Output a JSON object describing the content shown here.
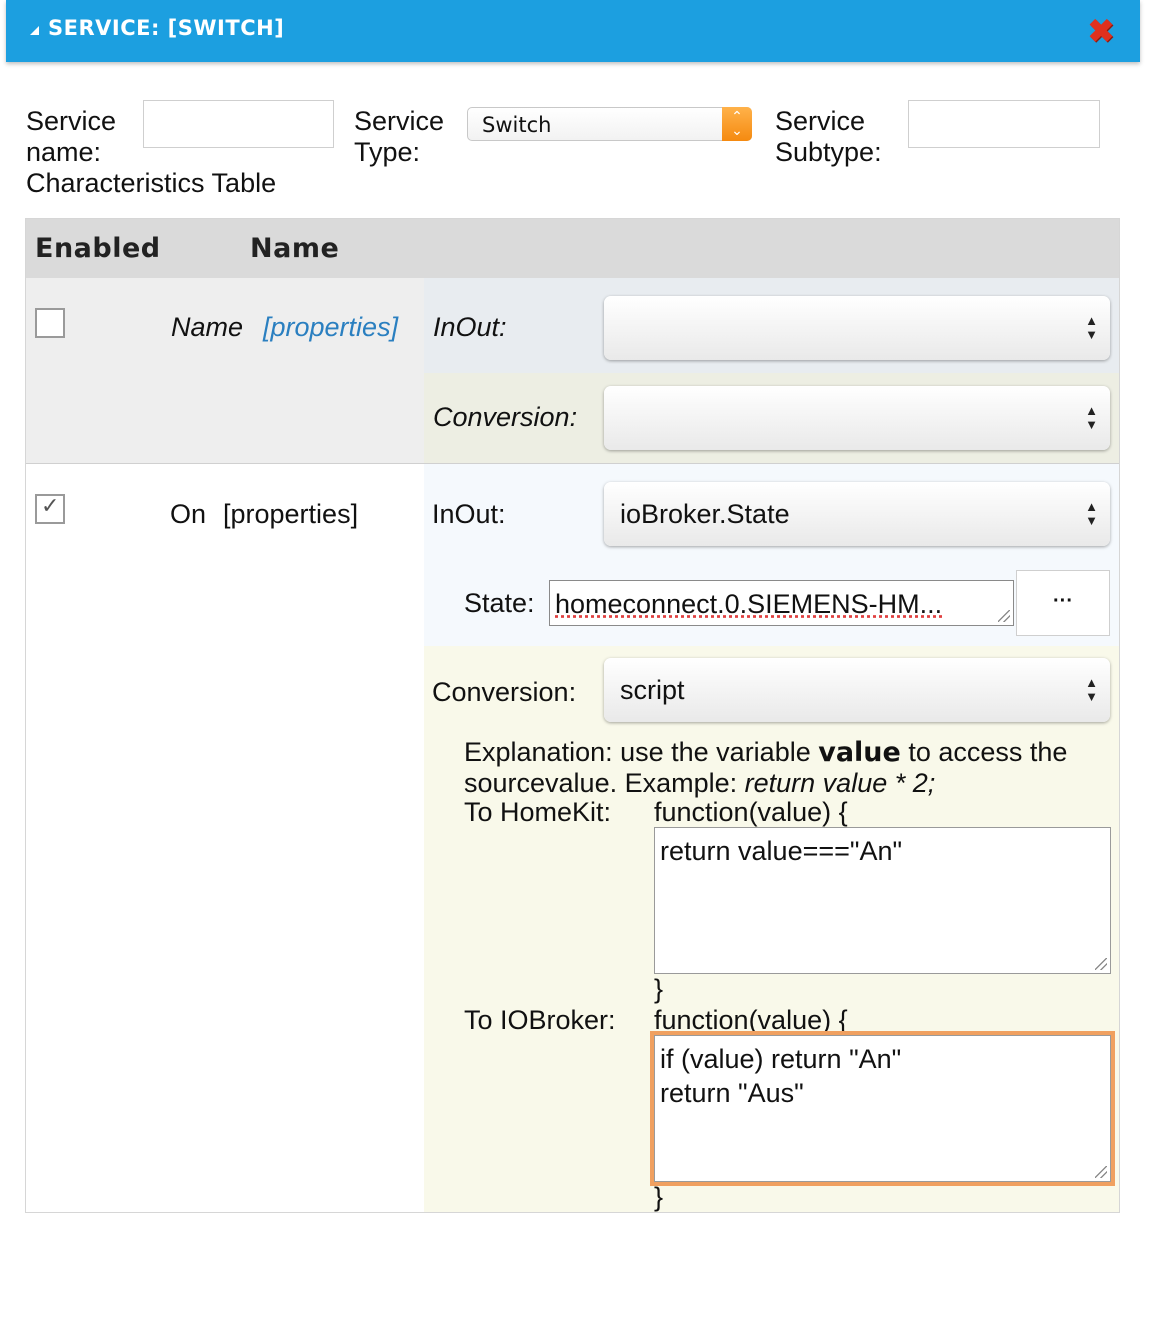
{
  "dialog": {
    "title": "SERVICE: [SWITCH]"
  },
  "form": {
    "service_name_label": "Service name:",
    "service_name_value": "",
    "service_type_label": "Service Type:",
    "service_type_value": "Switch",
    "service_subtype_label": "Service Subtype:",
    "service_subtype_value": "",
    "characteristics_table_label": "Characteristics Table"
  },
  "table": {
    "headers": {
      "enabled": "Enabled",
      "name": "Name"
    },
    "rows": [
      {
        "enabled": false,
        "name": "Name",
        "properties_link": "[properties]",
        "inout_label": "InOut:",
        "inout_value": "",
        "conversion_label": "Conversion:",
        "conversion_value": ""
      },
      {
        "enabled": true,
        "name": "On",
        "properties_link": "[properties]",
        "inout_label": "InOut:",
        "inout_value": "ioBroker.State",
        "state_label": "State:",
        "state_value": "homeconnect.0.SIEMENS-HM...",
        "browse_button": "···",
        "conversion_label": "Conversion:",
        "conversion_value": "script",
        "explanation_prefix": "Explanation: use the variable ",
        "explanation_bold": "value",
        "explanation_mid": " to access the sourcevalue. Example: ",
        "explanation_example": "return value * 2;",
        "to_homekit_label": "To HomeKit:",
        "to_homekit_open": "function(value) {",
        "to_homekit_code": "return value===\"An\"",
        "to_homekit_close": "}",
        "to_iobroker_label": "To IOBroker:",
        "to_iobroker_open": "function(value) {",
        "to_iobroker_code": "if (value) return \"An\"\nreturn \"Aus\"",
        "to_iobroker_close": "}"
      }
    ]
  },
  "icons": {
    "collapse": "triangle-collapse-icon",
    "close": "close-x-icon",
    "select_arrows": "updown-arrows-icon",
    "checkmark": "checkmark-icon",
    "resize": "resize-grip-icon"
  },
  "colors": {
    "header_bg": "#1c9fe0",
    "close_icon": "#e0301e",
    "link": "#2a7fc0",
    "focus_ring": "#f0a060",
    "inout_zone": "#f5f9fd",
    "conversion_zone": "#f9f9ea"
  }
}
